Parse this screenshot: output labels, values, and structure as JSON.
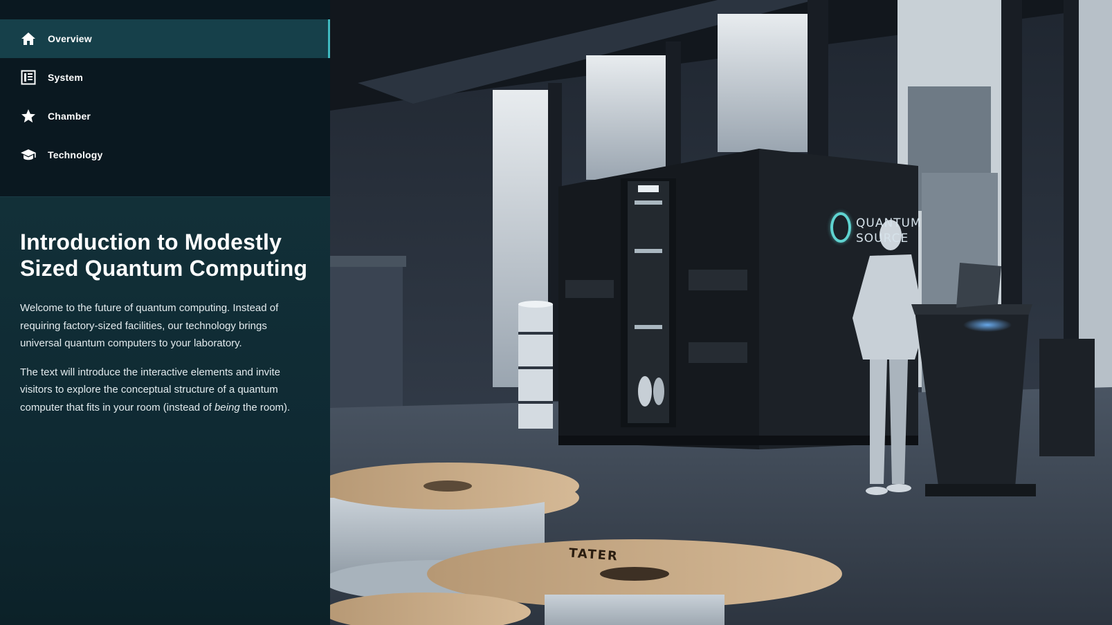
{
  "nav": {
    "items": [
      {
        "label": "Overview",
        "icon": "home-icon",
        "active": true
      },
      {
        "label": "System",
        "icon": "document-icon",
        "active": false
      },
      {
        "label": "Chamber",
        "icon": "star-icon",
        "active": false
      },
      {
        "label": "Technology",
        "icon": "mortarboard-icon",
        "active": false
      }
    ]
  },
  "content": {
    "title": "Introduction to Modestly Sized Quantum Computing",
    "paragraph1": "Welcome to the future of quantum computing. Instead of requiring factory-sized facilities, our technology brings universal quantum computers to your laboratory.",
    "paragraph2_before": "The text will introduce the interactive elements and invite visitors to explore the conceptual structure of a quantum computer that fits in your room (instead of ",
    "paragraph2_emphasis": "being",
    "paragraph2_after": " the room)."
  },
  "scene": {
    "brand_line1": "QUANTUM",
    "brand_line2": "SOURCE",
    "spool_label": "TATER"
  },
  "colors": {
    "accent": "#3fb9c0",
    "nav_active_bg": "#16404a",
    "sidebar_bg": "#0a1820",
    "content_bg": "#123038",
    "brand_ring": "#5fd3d0"
  }
}
